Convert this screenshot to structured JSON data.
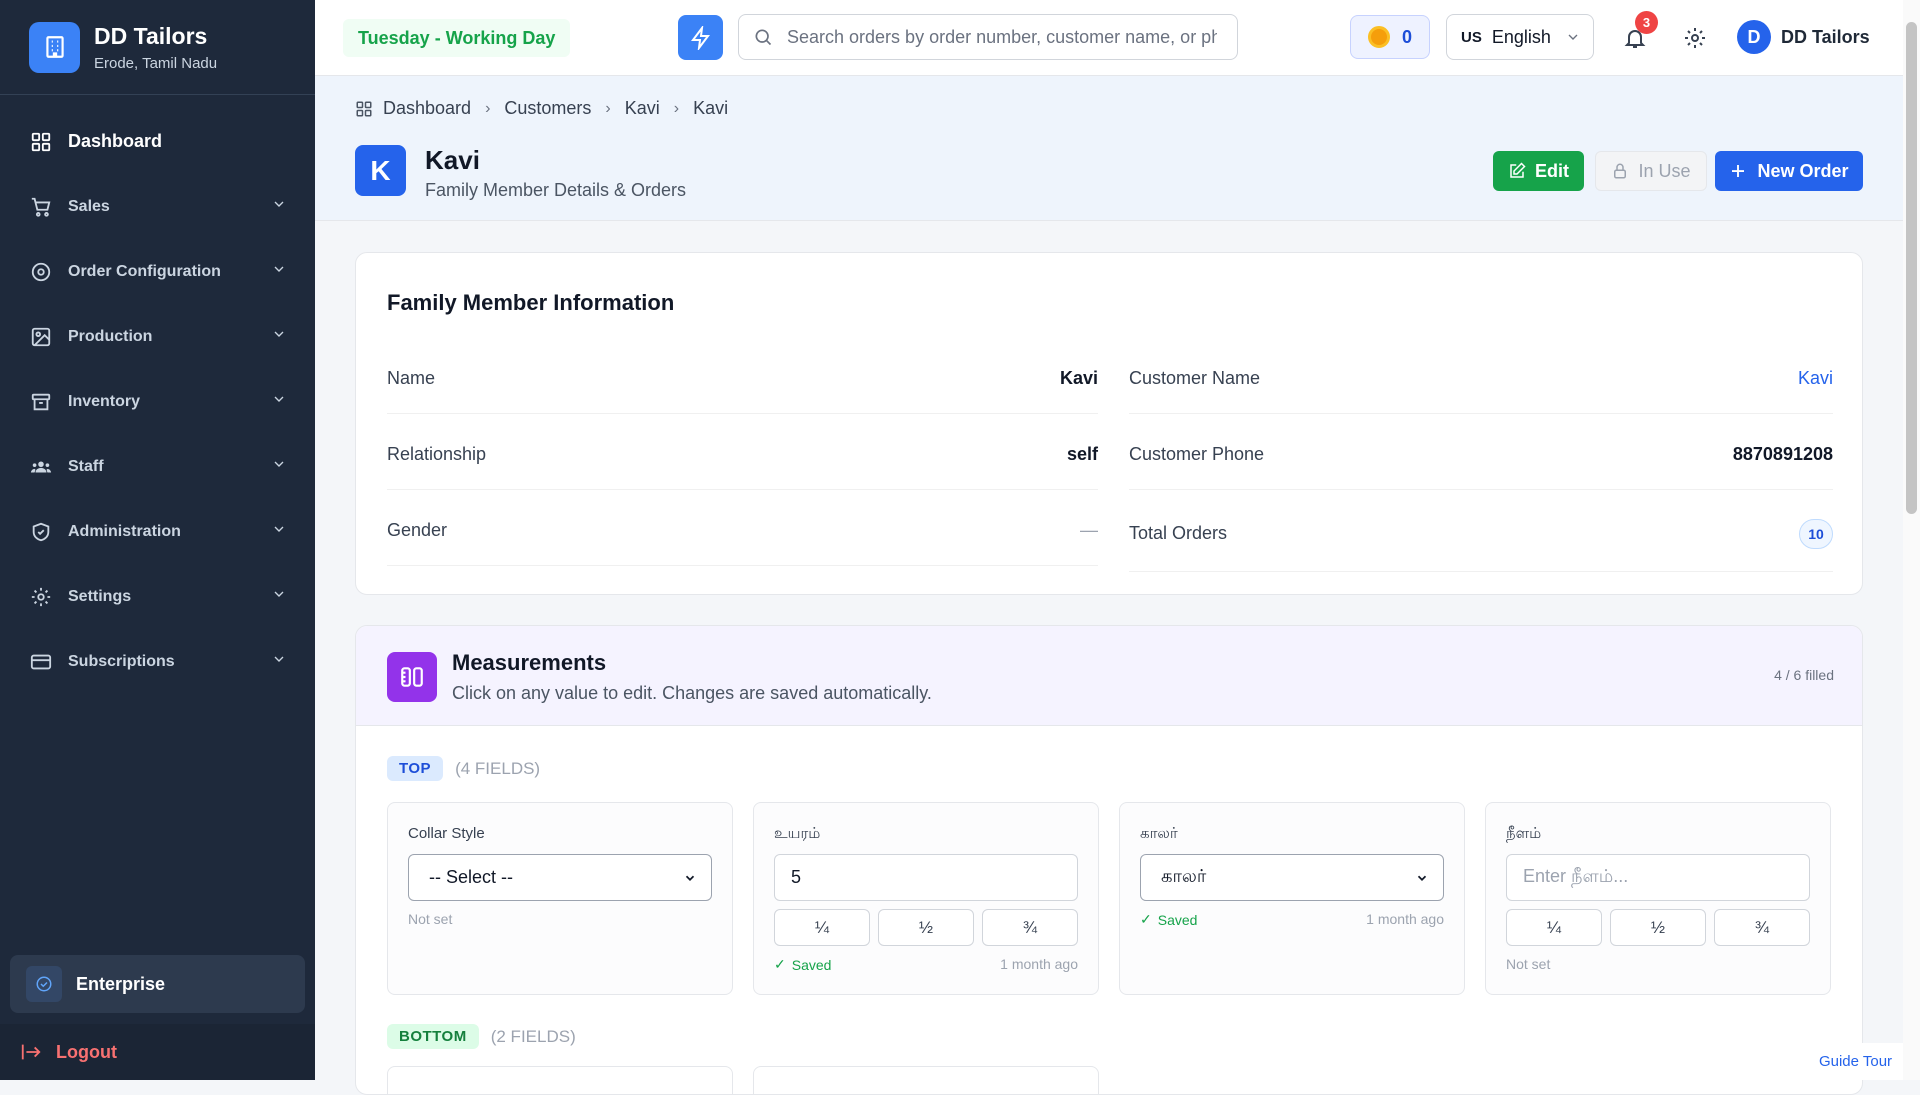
{
  "brand": {
    "title": "DD Tailors",
    "subtitle": "Erode, Tamil Nadu"
  },
  "sidebar": {
    "items": [
      {
        "label": "Dashboard",
        "icon": "grid-icon"
      },
      {
        "label": "Sales",
        "icon": "cart-icon"
      },
      {
        "label": "Order Configuration",
        "icon": "cog-icon"
      },
      {
        "label": "Production",
        "icon": "image-icon"
      },
      {
        "label": "Inventory",
        "icon": "archive-icon"
      },
      {
        "label": "Staff",
        "icon": "users-icon"
      },
      {
        "label": "Administration",
        "icon": "shield-icon"
      },
      {
        "label": "Settings",
        "icon": "gear-icon"
      },
      {
        "label": "Subscriptions",
        "icon": "card-icon"
      }
    ],
    "plan": "Enterprise",
    "logout": "Logout"
  },
  "topbar": {
    "workday": "Tuesday - Working Day",
    "search_placeholder": "Search orders by order number, customer name, or phone",
    "coins": "0",
    "lang_code": "US",
    "lang": "English",
    "notifications": "3",
    "user_initial": "D",
    "user_name": "DD Tailors"
  },
  "breadcrumb": [
    "Dashboard",
    "Customers",
    "Kavi",
    "Kavi"
  ],
  "page": {
    "initial": "K",
    "title": "Kavi",
    "subtitle": "Family Member Details & Orders",
    "edit": "Edit",
    "in_use": "In Use",
    "new_order": "New Order"
  },
  "info": {
    "title": "Family Member Information",
    "left": [
      {
        "k": "Name",
        "v": "Kavi"
      },
      {
        "k": "Relationship",
        "v": "self"
      },
      {
        "k": "Gender",
        "v": "—"
      }
    ],
    "right": [
      {
        "k": "Customer Name",
        "v": "Kavi"
      },
      {
        "k": "Customer Phone",
        "v": "8870891208"
      },
      {
        "k": "Total Orders",
        "v": "10"
      }
    ]
  },
  "measurements": {
    "title": "Measurements",
    "subtitle": "Click on any value to edit. Changes are saved automatically.",
    "count": "4 / 6 filled",
    "top_tag": "TOP",
    "top_count": "(4 FIELDS)",
    "bottom_tag": "BOTTOM",
    "bottom_count": "(2 FIELDS)",
    "fields": [
      {
        "label": "Collar Style",
        "value": "-- Select --",
        "status": "Not set",
        "ago": ""
      },
      {
        "label": "உயரம்",
        "value": "5",
        "status": "Saved",
        "ago": "1 month ago"
      },
      {
        "label": "காலர்",
        "value": "காலர்",
        "status": "Saved",
        "ago": "1 month ago"
      },
      {
        "label": "நீளம்",
        "placeholder": "Enter நீளம்...",
        "status": "Not set",
        "ago": ""
      }
    ],
    "fractions": [
      "¼",
      "½",
      "¾"
    ]
  },
  "guide": "Guide Tour",
  "colors": {
    "sidebar": "#1e293b",
    "primary": "#2563eb",
    "success": "#16a34a",
    "purple": "#9333ea"
  }
}
